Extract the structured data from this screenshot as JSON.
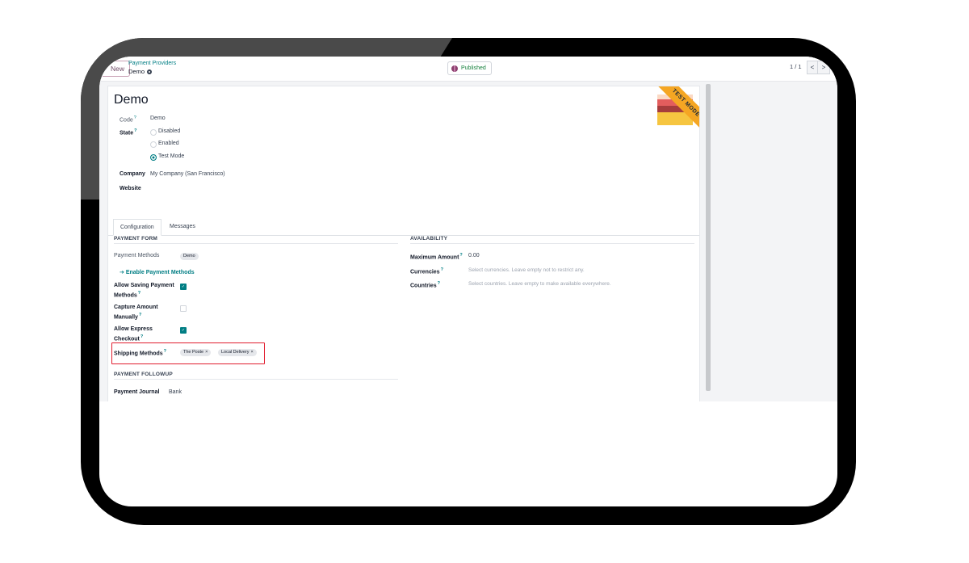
{
  "control_panel": {
    "new_button": "New",
    "breadcrumb_parent": "Payment Providers",
    "breadcrumb_current": "Demo",
    "published_label": "Published",
    "pager": "1 / 1",
    "pager_prev": "<",
    "pager_next": ">"
  },
  "form": {
    "title": "Demo",
    "code_label": "Code",
    "code_value": "Demo",
    "state_label": "State",
    "state_options": [
      "Disabled",
      "Enabled",
      "Test Mode"
    ],
    "state_selected": "Test Mode",
    "company_label": "Company",
    "company_value": "My Company (San Francisco)",
    "website_label": "Website",
    "ribbon": "TEST MODE",
    "help_mark": "?"
  },
  "tabs": [
    "Configuration",
    "Messages"
  ],
  "payment_form": {
    "section": "PAYMENT FORM",
    "payment_methods_label": "Payment Methods",
    "payment_methods_tag": "Demo",
    "enable_link": "Enable Payment Methods",
    "allow_saving_label_1": "Allow Saving Payment",
    "allow_saving_label_2": "Methods",
    "allow_saving": true,
    "capture_label_1": "Capture Amount",
    "capture_label_2": "Manually",
    "capture": false,
    "express_label_1": "Allow Express",
    "express_label_2": "Checkout",
    "express": true,
    "shipping_label": "Shipping Methods",
    "shipping_tags": [
      "The Poste",
      "Local Delivery"
    ],
    "remove_mark": "×",
    "check_mark": "✓"
  },
  "availability": {
    "section": "AVAILABILITY",
    "max_amount_label": "Maximum Amount",
    "max_amount_value": "0.00",
    "currencies_label": "Currencies",
    "currencies_placeholder": "Select currencies. Leave empty not to restrict any.",
    "countries_label": "Countries",
    "countries_placeholder": "Select countries. Leave empty to make available everywhere."
  },
  "payment_followup": {
    "section": "PAYMENT FOLLOWUP",
    "journal_label": "Payment Journal",
    "journal_value": "Bank"
  },
  "colors": {
    "brand": "#714b67",
    "accent": "#017e84",
    "highlight": "#e11d2f",
    "ribbon": "#f5a623"
  }
}
